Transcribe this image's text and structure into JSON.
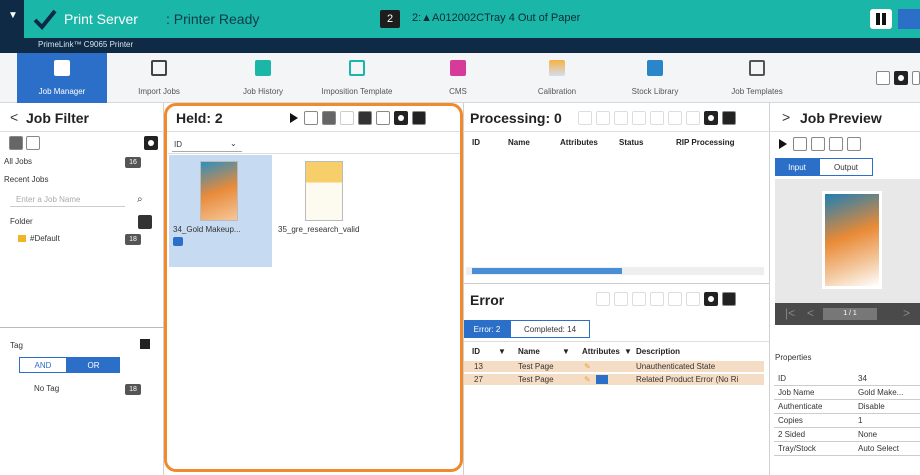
{
  "topbar": {
    "menu_icon": "chevron-down-icon",
    "status_icon": "check-icon",
    "server_label": "Print Server",
    "ready_label": ": Printer Ready",
    "alert_count": "2",
    "alert_text": "2:▲A012002CTray 4 Out of Paper",
    "pause_icon": "pause-icon",
    "play_icon": "play-icon"
  },
  "subbar": {
    "printer_name": "PrimeLink™ C9065 Printer"
  },
  "toolbar": {
    "items": [
      {
        "label": "Job Manager",
        "icon": "job-manager-icon"
      },
      {
        "label": "Import Jobs",
        "icon": "import-icon"
      },
      {
        "label": "Job History",
        "icon": "history-icon"
      },
      {
        "label": "Imposition Template",
        "icon": "imposition-icon"
      },
      {
        "label": "CMS",
        "icon": "cms-icon"
      },
      {
        "label": "Calibration",
        "icon": "calibration-icon"
      },
      {
        "label": "Stock Library",
        "icon": "stock-library-icon"
      },
      {
        "label": "Job Templates",
        "icon": "job-templates-icon"
      }
    ],
    "more_icon": "more-icon",
    "settings_icon": "gear-icon",
    "accent": "#2b6fc8"
  },
  "job_filter": {
    "title": "Job Filter",
    "all_jobs_label": "All Jobs",
    "all_jobs_count": "16",
    "recent_jobs_label": "Recent Jobs",
    "search_placeholder": "Enter a Job Name",
    "folder_label": "Folder",
    "folder_name": "#Default",
    "folder_count": "18",
    "tag_label": "Tag",
    "and_label": "AND",
    "or_label": "OR",
    "no_tag_label": "No Tag",
    "no_tag_count": "18"
  },
  "held": {
    "title": "Held: 2",
    "sort_value": "ID",
    "jobs": [
      {
        "name": "34_Gold Makeup...",
        "selected": true
      },
      {
        "name": "35_gre_research_valid",
        "selected": false
      }
    ]
  },
  "processing": {
    "title": "Processing: 0",
    "columns": [
      "ID",
      "Name",
      "Attributes",
      "Status",
      "RIP Processing"
    ]
  },
  "error": {
    "title": "Error",
    "tabs": [
      "Error: 2",
      "Completed: 14"
    ],
    "columns": [
      "ID",
      "Name",
      "Attributes",
      "Description"
    ],
    "rows": [
      {
        "id": "13",
        "name": "Test Page",
        "desc": "Unauthenticated State"
      },
      {
        "id": "27",
        "name": "Test Page",
        "desc": "Related Product Error (No Ri"
      }
    ]
  },
  "preview": {
    "title": "Job Preview",
    "tabs": [
      "Input",
      "Output"
    ],
    "page_counter": "1 / 1",
    "properties_label": "Properties",
    "properties": [
      {
        "key": "ID",
        "value": "34"
      },
      {
        "key": "Job Name",
        "value": "Gold Make..."
      },
      {
        "key": "Authenticate",
        "value": "Disable"
      },
      {
        "key": "Copies",
        "value": "1"
      },
      {
        "key": "2 Sided",
        "value": "None"
      },
      {
        "key": "Tray/Stock",
        "value": "Auto Select"
      }
    ]
  }
}
